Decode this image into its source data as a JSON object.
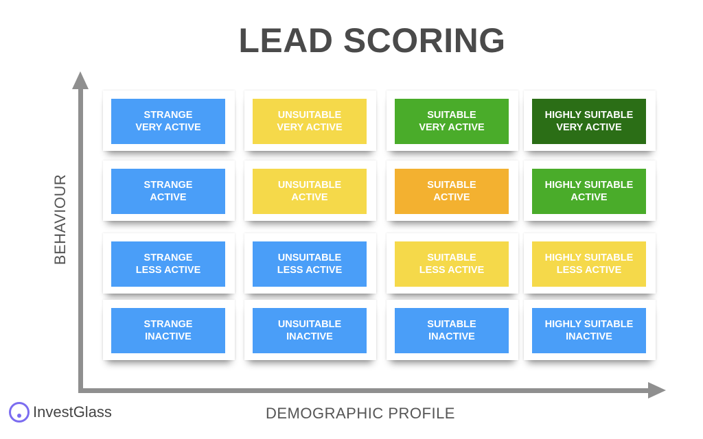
{
  "title": "LEAD SCORING",
  "axes": {
    "y_label": "BEHAVIOUR",
    "x_label": "DEMOGRAPHIC PROFILE"
  },
  "colors": {
    "blue": "#4a9ef8",
    "yellow": "#f5d94a",
    "green": "#4aac2a",
    "dark_green": "#2b6e16",
    "orange": "#f3b130"
  },
  "columns": [
    "STRANGE",
    "UNSUITABLE",
    "SUITABLE",
    "HIGHLY SUITABLE"
  ],
  "rows": [
    "VERY ACTIVE",
    "ACTIVE",
    "LESS ACTIVE",
    "INACTIVE"
  ],
  "cells": [
    [
      {
        "line1": "STRANGE",
        "line2": "VERY ACTIVE",
        "color": "#4a9ef8"
      },
      {
        "line1": "UNSUITABLE",
        "line2": "VERY ACTIVE",
        "color": "#f5d94a"
      },
      {
        "line1": "SUITABLE",
        "line2": "VERY ACTIVE",
        "color": "#4aac2a"
      },
      {
        "line1": "HIGHLY SUITABLE",
        "line2": "VERY ACTIVE",
        "color": "#2b6e16"
      }
    ],
    [
      {
        "line1": "STRANGE",
        "line2": "ACTIVE",
        "color": "#4a9ef8"
      },
      {
        "line1": "UNSUITABLE",
        "line2": "ACTIVE",
        "color": "#f5d94a"
      },
      {
        "line1": "SUITABLE",
        "line2": "ACTIVE",
        "color": "#f3b130"
      },
      {
        "line1": "HIGHLY SUITABLE",
        "line2": "ACTIVE",
        "color": "#4aac2a"
      }
    ],
    [
      {
        "line1": "STRANGE",
        "line2": "LESS ACTIVE",
        "color": "#4a9ef8"
      },
      {
        "line1": "UNSUITABLE",
        "line2": "LESS ACTIVE",
        "color": "#4a9ef8"
      },
      {
        "line1": "SUITABLE",
        "line2": "LESS ACTIVE",
        "color": "#f5d94a"
      },
      {
        "line1": "HIGHLY SUITABLE",
        "line2": "LESS ACTIVE",
        "color": "#f5d94a"
      }
    ],
    [
      {
        "line1": "STRANGE",
        "line2": "INACTIVE",
        "color": "#4a9ef8"
      },
      {
        "line1": "UNSUITABLE",
        "line2": "INACTIVE",
        "color": "#4a9ef8"
      },
      {
        "line1": "SUITABLE",
        "line2": "INACTIVE",
        "color": "#4a9ef8"
      },
      {
        "line1": "HIGHLY SUITABLE",
        "line2": "INACTIVE",
        "color": "#4a9ef8"
      }
    ]
  ],
  "logo": {
    "text": "InvestGlass",
    "icon": "investglass-logo-icon"
  }
}
